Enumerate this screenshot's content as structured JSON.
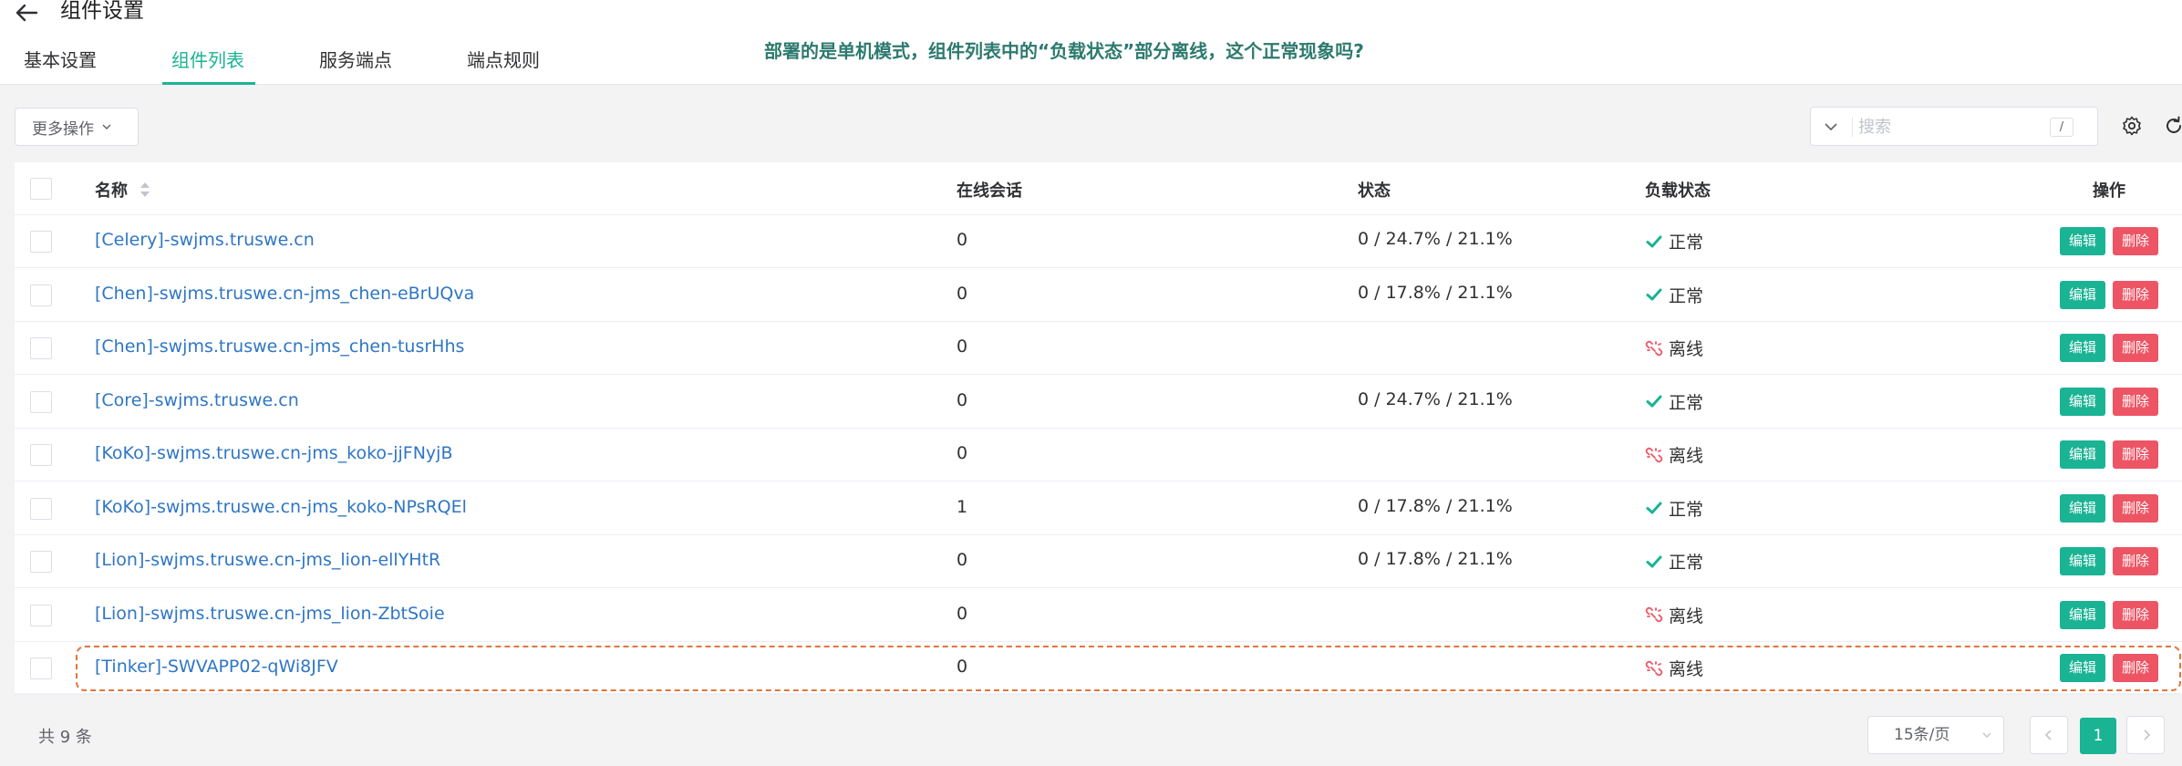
{
  "header": {
    "title": "组件设置",
    "tabs": [
      {
        "label": "基本设置"
      },
      {
        "label": "组件列表"
      },
      {
        "label": "服务端点"
      },
      {
        "label": "端点规则"
      }
    ],
    "active_tab": "组件列表",
    "question": "部署的是单机模式，组件列表中的“负载状态”部分离线，这个正常现象吗?"
  },
  "toolbar": {
    "more_actions_label": "更多操作",
    "search_placeholder": "搜索",
    "search_shortcut": "/"
  },
  "table": {
    "columns": {
      "name": "名称",
      "sessions": "在线会话",
      "status": "状态",
      "load": "负载状态",
      "actions": "操作"
    },
    "edit_label": "编辑",
    "delete_label": "删除",
    "rows": [
      {
        "name": "[Celery]-swjms.truswe.cn",
        "sessions": "0",
        "status": "0 / 24.7% / 21.1%",
        "load": "正常",
        "load_ok": true
      },
      {
        "name": "[Chen]-swjms.truswe.cn-jms_chen-eBrUQva",
        "sessions": "0",
        "status": "0 / 17.8% / 21.1%",
        "load": "正常",
        "load_ok": true
      },
      {
        "name": "[Chen]-swjms.truswe.cn-jms_chen-tusrHhs",
        "sessions": "0",
        "status": "",
        "load": "离线",
        "load_ok": false
      },
      {
        "name": "[Core]-swjms.truswe.cn",
        "sessions": "0",
        "status": "0 / 24.7% / 21.1%",
        "load": "正常",
        "load_ok": true
      },
      {
        "name": "[KoKo]-swjms.truswe.cn-jms_koko-jjFNyjB",
        "sessions": "0",
        "status": "",
        "load": "离线",
        "load_ok": false
      },
      {
        "name": "[KoKo]-swjms.truswe.cn-jms_koko-NPsRQEl",
        "sessions": "1",
        "status": "0 / 17.8% / 21.1%",
        "load": "正常",
        "load_ok": true
      },
      {
        "name": "[Lion]-swjms.truswe.cn-jms_lion-ellYHtR",
        "sessions": "0",
        "status": "0 / 17.8% / 21.1%",
        "load": "正常",
        "load_ok": true
      },
      {
        "name": "[Lion]-swjms.truswe.cn-jms_lion-ZbtSoie",
        "sessions": "0",
        "status": "",
        "load": "离线",
        "load_ok": false
      },
      {
        "name": "[Tinker]-SWVAPP02-qWi8JFV",
        "sessions": "0",
        "status": "",
        "load": "离线",
        "load_ok": false
      }
    ]
  },
  "footer": {
    "total": "共 9 条",
    "page_size": "15条/页",
    "current_page": "1"
  },
  "colors": {
    "accent": "#1ab394",
    "danger": "#ed5565",
    "link": "#2f76c4",
    "question": "#2d7a6e",
    "highlight": "#e0763c"
  },
  "icons": {
    "back": "arrow-left-icon",
    "ok": "check-icon",
    "offline": "broken-link-icon",
    "settings": "gear-icon",
    "refresh": "refresh-icon"
  }
}
